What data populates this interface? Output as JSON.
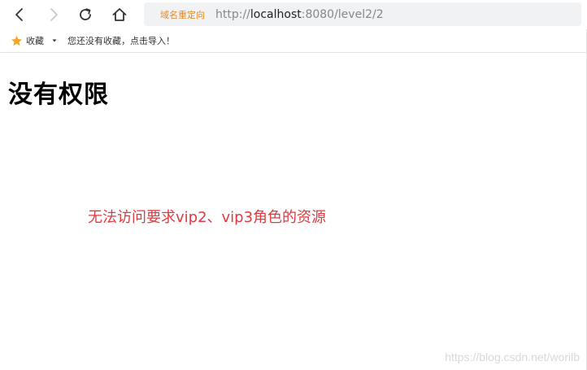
{
  "toolbar": {
    "icons": {
      "back": "chevron-left-icon",
      "forward": "chevron-right-icon",
      "reload": "reload-icon",
      "home": "home-icon"
    },
    "redirect_badge": "域名重定向",
    "url_scheme": "http://",
    "url_host": "localhost",
    "url_rest": ":8080/level2/2"
  },
  "bookmarks": {
    "label": "收藏",
    "hint": "您还没有收藏，点击导入！",
    "star_color": "#f5a623"
  },
  "page": {
    "title": "没有权限",
    "message": "无法访问要求vip2、vip3角色的资源",
    "message_color": "#e0393e"
  },
  "watermark": "https://blog.csdn.net/worilb"
}
